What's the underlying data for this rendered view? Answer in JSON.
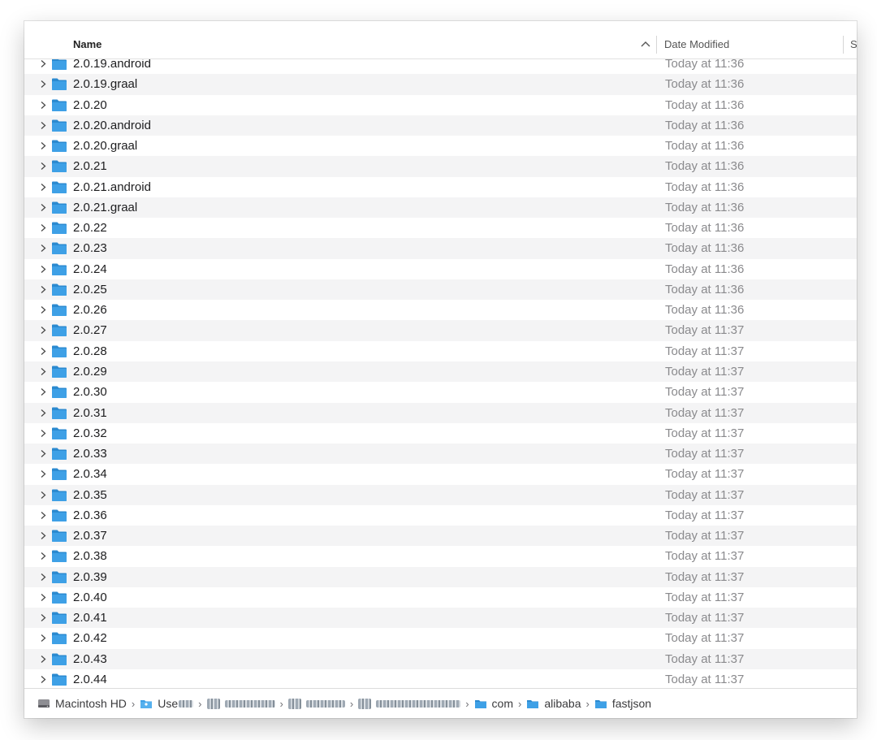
{
  "columns": {
    "name": "Name",
    "date_modified": "Date Modified",
    "size": "S"
  },
  "rows": [
    {
      "name": "2.0.19.android",
      "date": "Today at 11:36"
    },
    {
      "name": "2.0.19.graal",
      "date": "Today at 11:36"
    },
    {
      "name": "2.0.20",
      "date": "Today at 11:36"
    },
    {
      "name": "2.0.20.android",
      "date": "Today at 11:36"
    },
    {
      "name": "2.0.20.graal",
      "date": "Today at 11:36"
    },
    {
      "name": "2.0.21",
      "date": "Today at 11:36"
    },
    {
      "name": "2.0.21.android",
      "date": "Today at 11:36"
    },
    {
      "name": "2.0.21.graal",
      "date": "Today at 11:36"
    },
    {
      "name": "2.0.22",
      "date": "Today at 11:36"
    },
    {
      "name": "2.0.23",
      "date": "Today at 11:36"
    },
    {
      "name": "2.0.24",
      "date": "Today at 11:36"
    },
    {
      "name": "2.0.25",
      "date": "Today at 11:36"
    },
    {
      "name": "2.0.26",
      "date": "Today at 11:36"
    },
    {
      "name": "2.0.27",
      "date": "Today at 11:37"
    },
    {
      "name": "2.0.28",
      "date": "Today at 11:37"
    },
    {
      "name": "2.0.29",
      "date": "Today at 11:37"
    },
    {
      "name": "2.0.30",
      "date": "Today at 11:37"
    },
    {
      "name": "2.0.31",
      "date": "Today at 11:37"
    },
    {
      "name": "2.0.32",
      "date": "Today at 11:37"
    },
    {
      "name": "2.0.33",
      "date": "Today at 11:37"
    },
    {
      "name": "2.0.34",
      "date": "Today at 11:37"
    },
    {
      "name": "2.0.35",
      "date": "Today at 11:37"
    },
    {
      "name": "2.0.36",
      "date": "Today at 11:37"
    },
    {
      "name": "2.0.37",
      "date": "Today at 11:37"
    },
    {
      "name": "2.0.38",
      "date": "Today at 11:37"
    },
    {
      "name": "2.0.39",
      "date": "Today at 11:37"
    },
    {
      "name": "2.0.40",
      "date": "Today at 11:37"
    },
    {
      "name": "2.0.41",
      "date": "Today at 11:37"
    },
    {
      "name": "2.0.42",
      "date": "Today at 11:37"
    },
    {
      "name": "2.0.43",
      "date": "Today at 11:37"
    },
    {
      "name": "2.0.44",
      "date": "Today at 11:37"
    }
  ],
  "pathbar": {
    "disk": "Macintosh HD",
    "users": "Use",
    "com": "com",
    "alibaba": "alibaba",
    "fastjson": "fastjson",
    "separator": "›"
  },
  "colors": {
    "folder": "#3ea0e6",
    "folder_dark": "#2b8ad0",
    "row_alt": "#f4f4f5",
    "date_text": "#8a8a8d"
  },
  "icons": {
    "folder": "folder-icon",
    "disclosure": "chevron-right-icon",
    "disk": "hard-drive-icon",
    "sort": "chevron-up-icon"
  }
}
